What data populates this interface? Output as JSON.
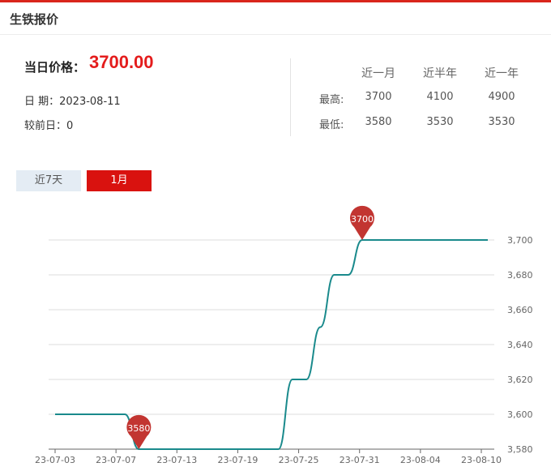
{
  "panel": {
    "title": "生铁报价",
    "price_label": "当日价格：",
    "price_value": "3700.00",
    "date_line": "日 期：2023-08-11",
    "prev_line": "较前日：0"
  },
  "stats": {
    "periods": [
      "近一月",
      "近半年",
      "近一年"
    ],
    "rows": [
      {
        "label": "最高:",
        "values": [
          "3700",
          "4100",
          "4900"
        ]
      },
      {
        "label": "最低:",
        "values": [
          "3580",
          "3530",
          "3530"
        ]
      }
    ]
  },
  "tabs": {
    "week": "近7天",
    "month": "1月",
    "active": "month"
  },
  "colors": {
    "accent": "#d9120f",
    "line": "#1a8a8c",
    "marker": "#c23531",
    "grid": "#dddddd"
  },
  "chart_data": {
    "type": "line",
    "title": "",
    "xlabel": "",
    "ylabel": "",
    "ylim": [
      3580,
      3700
    ],
    "yticks": [
      "3,580",
      "3,600",
      "3,620",
      "3,640",
      "3,660",
      "3,680",
      "3,700"
    ],
    "xticks": [
      "23-07-03",
      "23-07-07",
      "23-07-13",
      "23-07-19",
      "23-07-25",
      "23-07-31",
      "23-08-04",
      "23-08-10"
    ],
    "x": [
      "23-07-03",
      "23-07-04",
      "23-07-05",
      "23-07-06",
      "23-07-07",
      "23-07-08",
      "23-07-09",
      "23-07-10",
      "23-07-11",
      "23-07-12",
      "23-07-13",
      "23-07-14",
      "23-07-17",
      "23-07-18",
      "23-07-19",
      "23-07-20",
      "23-07-21",
      "23-07-24",
      "23-07-25",
      "23-07-26",
      "23-07-27",
      "23-07-28",
      "23-07-31",
      "23-08-01",
      "23-08-02",
      "23-08-03",
      "23-08-04",
      "23-08-07",
      "23-08-08",
      "23-08-09",
      "23-08-10",
      "23-08-11"
    ],
    "values": [
      3600,
      3600,
      3600,
      3600,
      3600,
      3600,
      3580,
      3580,
      3580,
      3580,
      3580,
      3580,
      3580,
      3580,
      3580,
      3580,
      3580,
      3620,
      3620,
      3650,
      3680,
      3680,
      3700,
      3700,
      3700,
      3700,
      3700,
      3700,
      3700,
      3700,
      3700,
      3700
    ],
    "markers": [
      {
        "label": "3580",
        "x": "23-07-09",
        "value": 3580
      },
      {
        "label": "3700",
        "x": "23-07-31",
        "value": 3700
      }
    ]
  }
}
